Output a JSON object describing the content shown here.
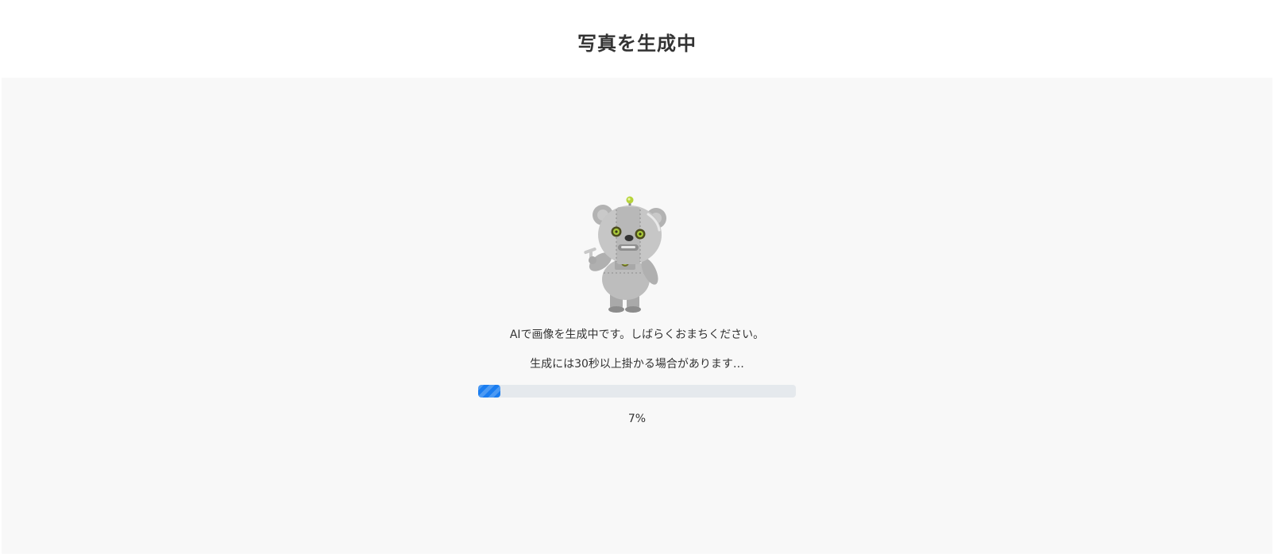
{
  "header": {
    "title": "写真を生成中"
  },
  "main": {
    "mascot_icon": "robot-bear-icon",
    "message_primary": "AIで画像を生成中です。しばらくおまちください。",
    "message_secondary": "生成には30秒以上掛かる場合があります…",
    "progress": {
      "percent_value": 7,
      "label": "7%",
      "fill_color": "#1a7df0",
      "track_color": "#e5e9ed"
    }
  }
}
